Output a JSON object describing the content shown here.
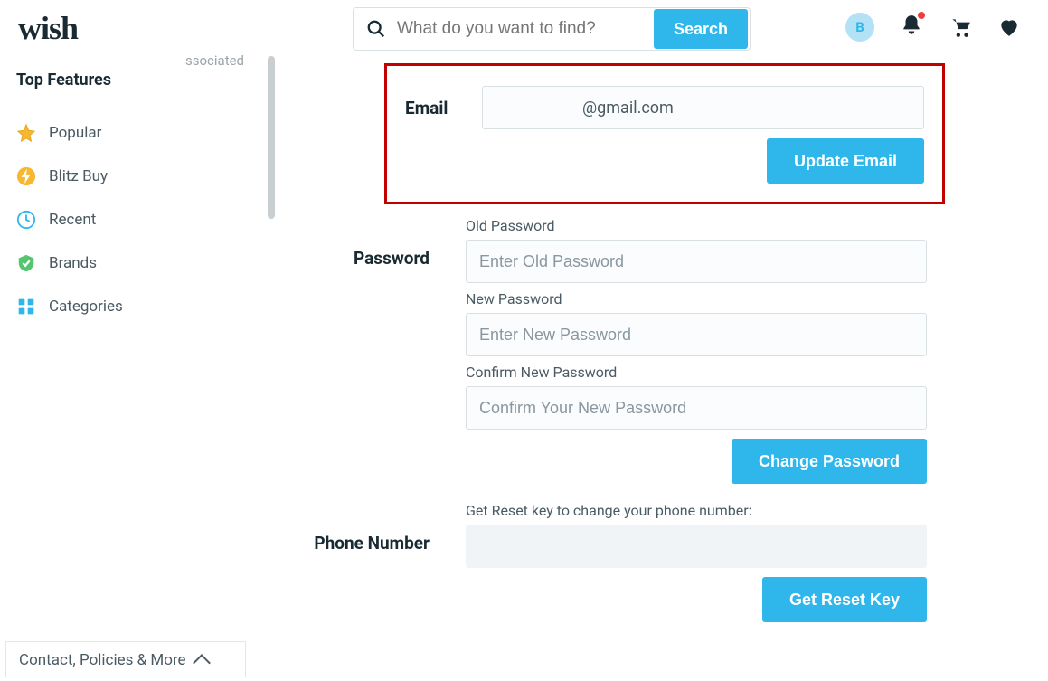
{
  "header": {
    "logo_text": "wish",
    "search_placeholder": "What do you want to find?",
    "search_button": "Search",
    "avatar_letter": "B"
  },
  "sidebar": {
    "heading": "Top Features",
    "truncated_fragment": "ssociated",
    "items": [
      {
        "icon": "star",
        "label": "Popular"
      },
      {
        "icon": "blitz",
        "label": "Blitz Buy"
      },
      {
        "icon": "clock",
        "label": "Recent"
      },
      {
        "icon": "check-shield",
        "label": "Brands"
      },
      {
        "icon": "grid",
        "label": "Categories"
      }
    ]
  },
  "settings": {
    "email": {
      "label": "Email",
      "value_suffix": "@gmail.com",
      "button": "Update Email"
    },
    "password": {
      "label": "Password",
      "old_label": "Old Password",
      "old_placeholder": "Enter Old Password",
      "new_label": "New Password",
      "new_placeholder": "Enter New Password",
      "confirm_label": "Confirm New Password",
      "confirm_placeholder": "Confirm Your New Password",
      "button": "Change Password"
    },
    "phone": {
      "label": "Phone Number",
      "helper": "Get Reset key to change your phone number:",
      "button": "Get Reset Key"
    }
  },
  "footer": {
    "pill": "Contact, Policies & More"
  }
}
